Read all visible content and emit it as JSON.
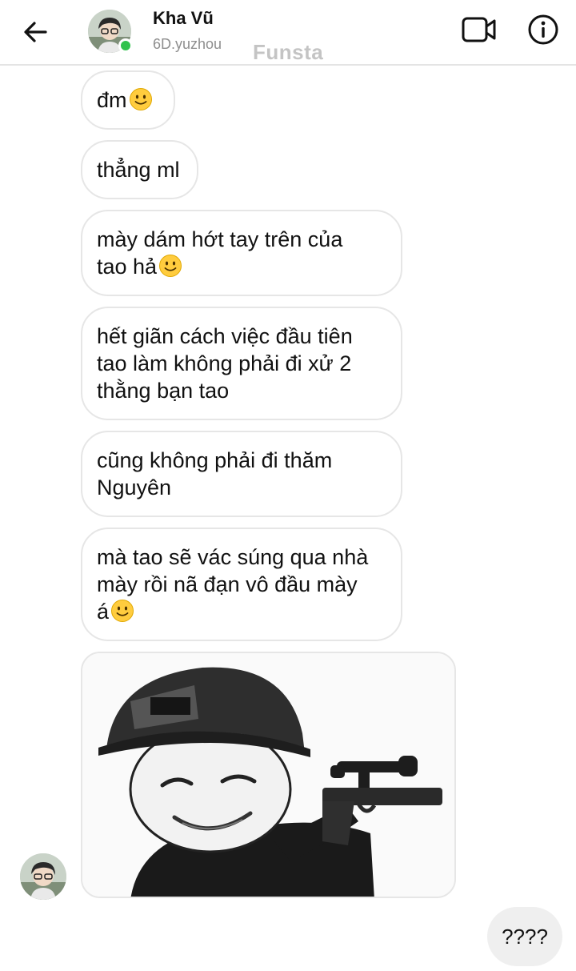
{
  "header": {
    "contact_name": "Kha Vũ",
    "contact_username": "6D.yuzhou",
    "watermark": "Funsta",
    "online_color": "#31c24d"
  },
  "icons": {
    "back": "arrow-left-icon",
    "video": "video-camera-icon",
    "info": "info-icon",
    "emoji": "slightly-smiling-face-icon"
  },
  "messages": [
    {
      "text": "đm",
      "emoji": true
    },
    {
      "text": "thẳng ml",
      "emoji": false
    },
    {
      "text": "mày dám hớt tay trên của\ntao hả",
      "emoji": true
    },
    {
      "text": "hết giãn cách việc đầu tiên\ntao làm không phải đi xử 2\nthằng bạn tao",
      "emoji": false
    },
    {
      "text": "cũng không phải đi thăm\nNguyên",
      "emoji": false
    },
    {
      "text": "mà tao sẽ vác súng qua nhà\nmày rồi nã đạn vô đầu mày\ná",
      "emoji": true
    }
  ],
  "sticker": {
    "description_icon": "meme-helmet-gun-sticker"
  },
  "outgoing": {
    "text": "????"
  }
}
